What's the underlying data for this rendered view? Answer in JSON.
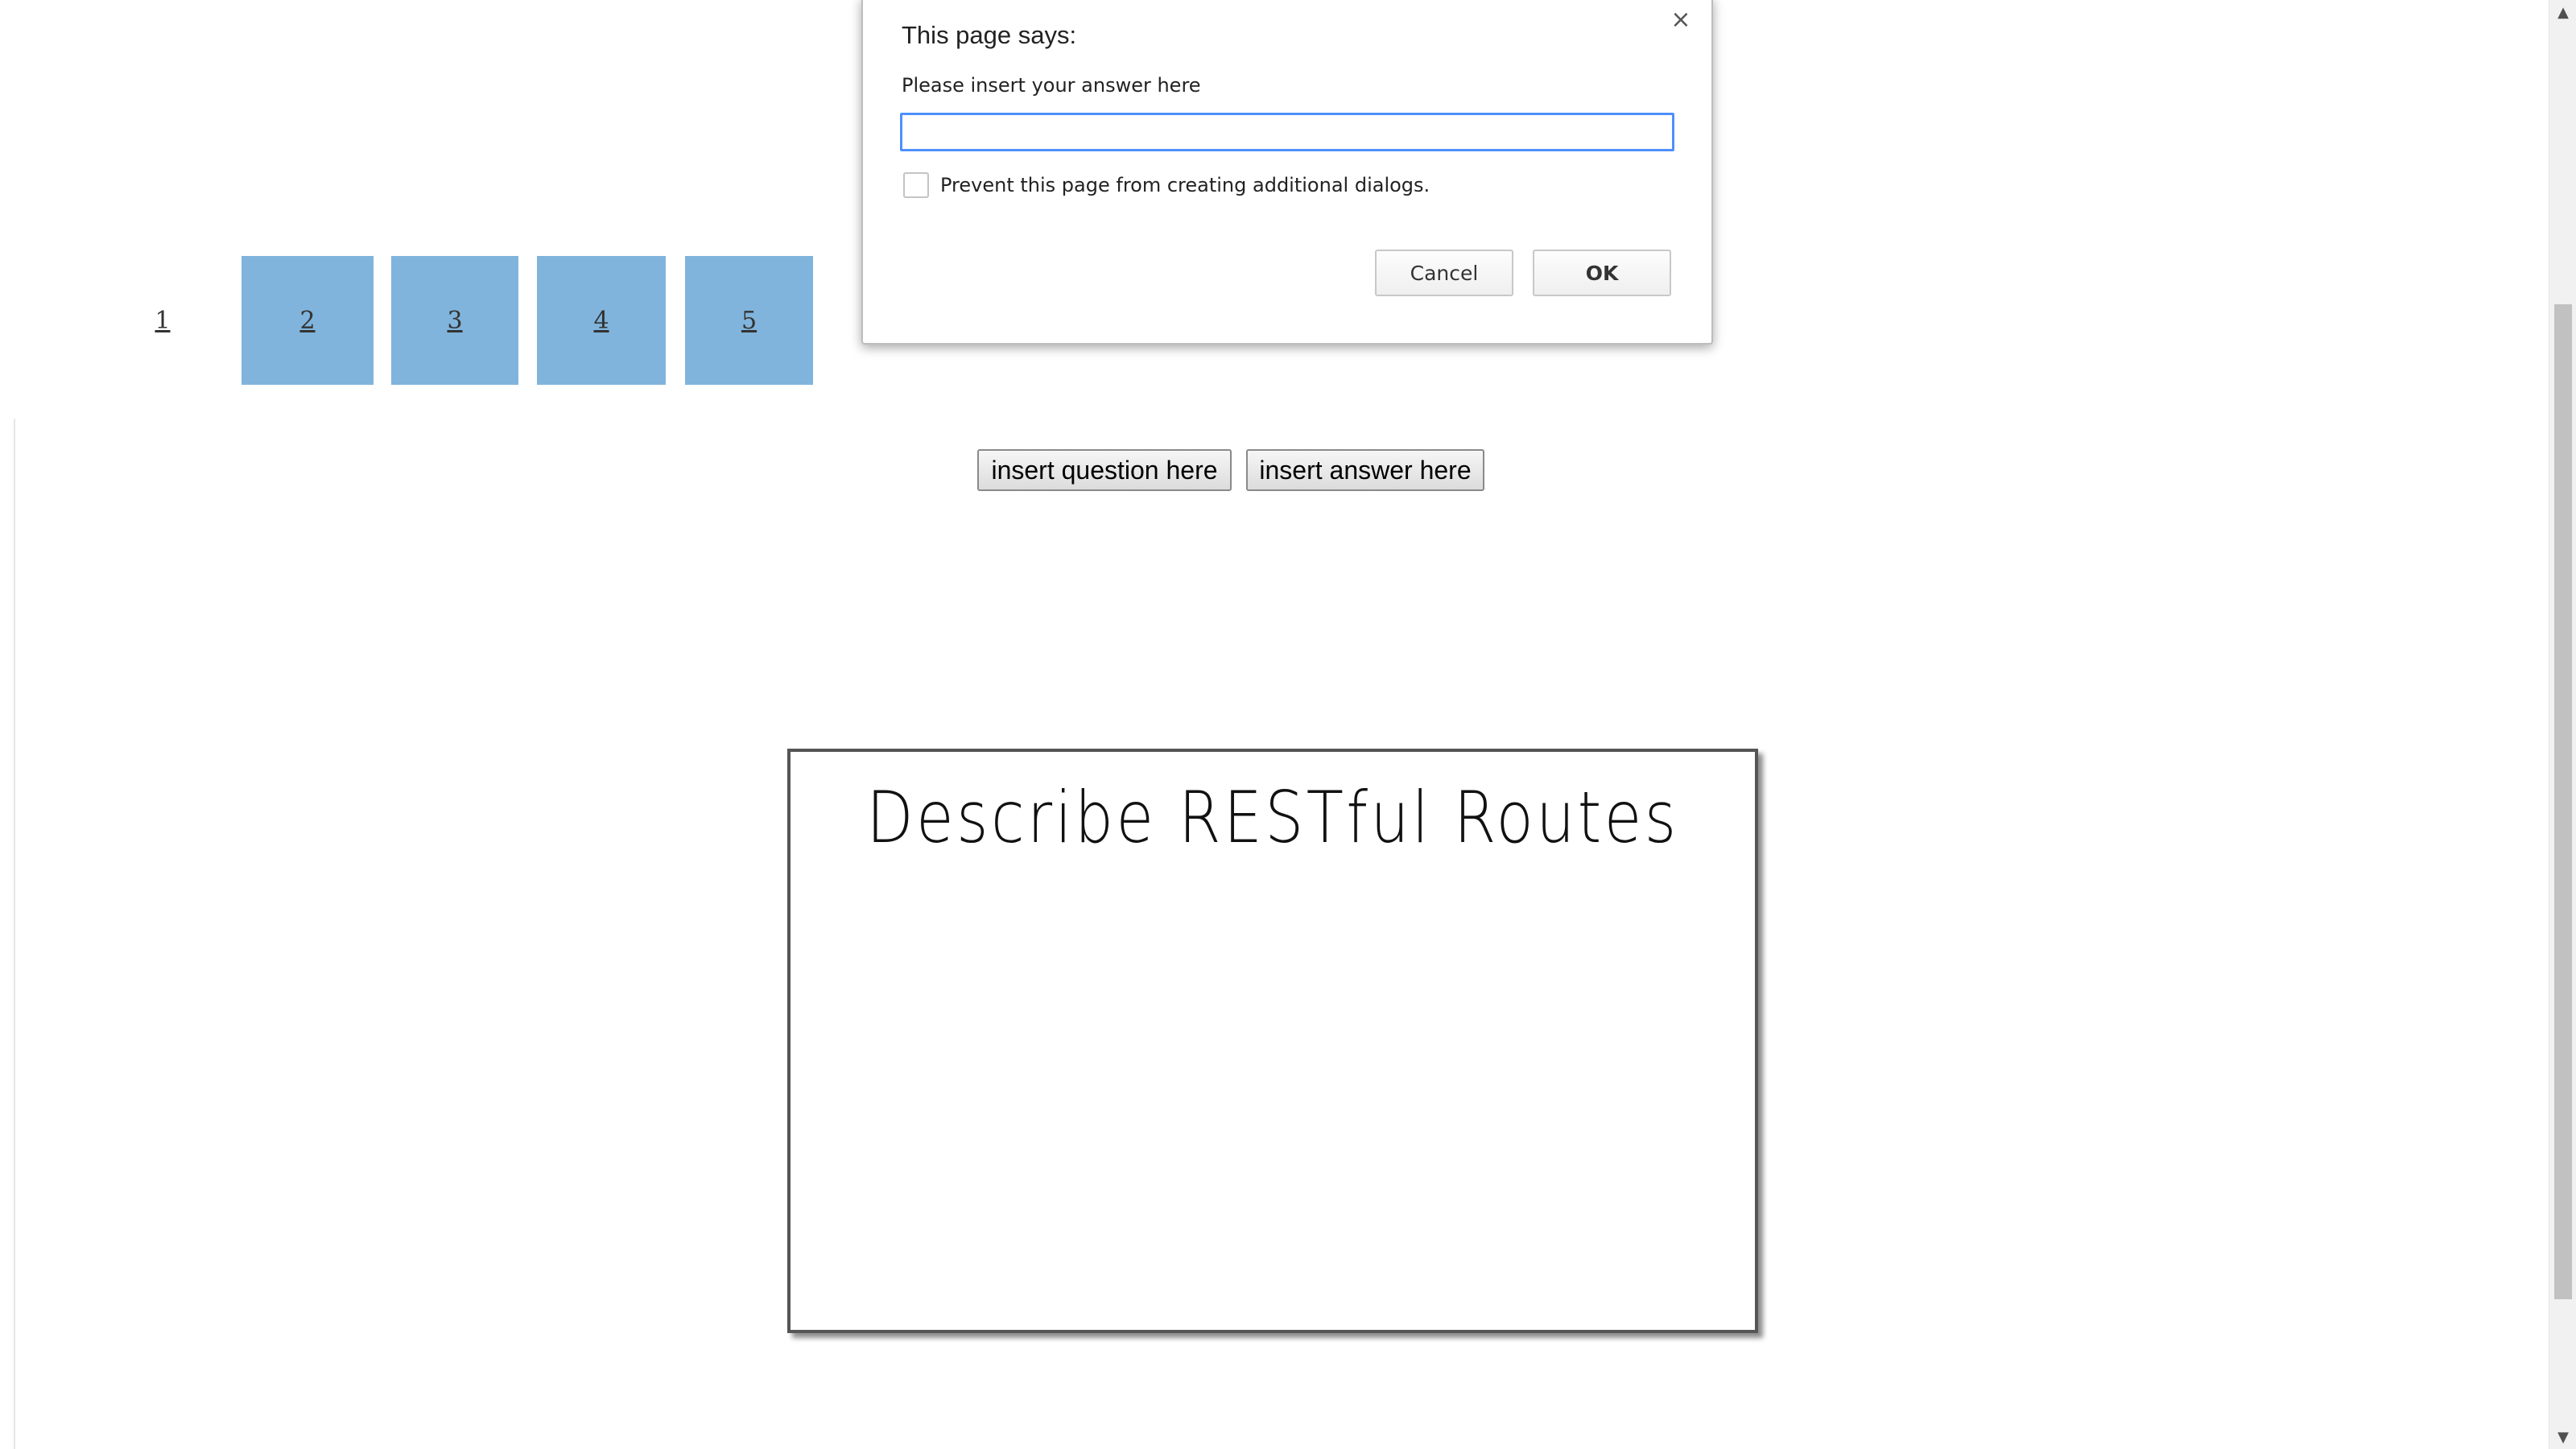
{
  "tabs": [
    {
      "label": "1",
      "style": "plain"
    },
    {
      "label": "2",
      "style": "filled"
    },
    {
      "label": "3",
      "style": "filled"
    },
    {
      "label": "4",
      "style": "filled"
    },
    {
      "label": "5",
      "style": "filled"
    }
  ],
  "actions": {
    "insert_question_label": "insert question here",
    "insert_answer_label": "insert answer here"
  },
  "card": {
    "text": "Describe RESTful Routes"
  },
  "dialog": {
    "title": "This page says:",
    "close_icon": "×",
    "prompt": "Please insert your answer here",
    "input_value": "",
    "checkbox_label": "Prevent this page from creating additional dialogs.",
    "cancel_label": "Cancel",
    "ok_label": "OK"
  },
  "scrollbar": {
    "up_icon": "▲",
    "down_icon": "▼"
  },
  "colors": {
    "tab_fill": "#80b4dc",
    "input_focus": "#4d90fe"
  }
}
